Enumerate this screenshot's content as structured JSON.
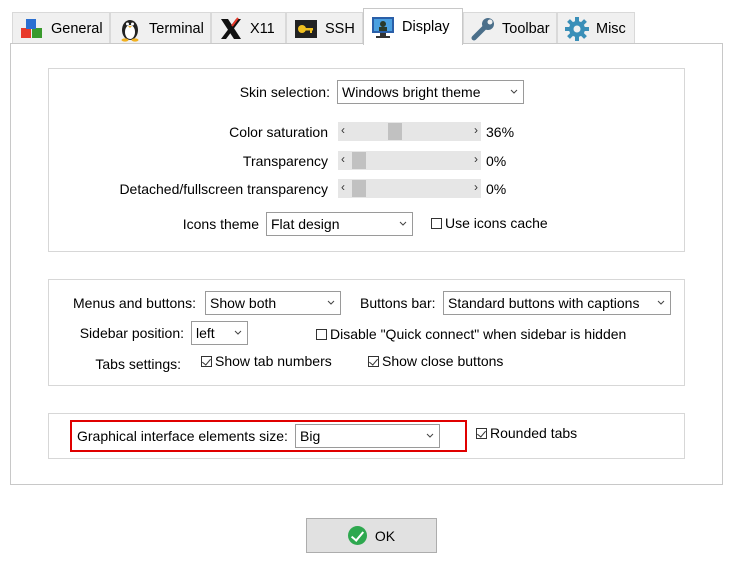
{
  "tabs": [
    {
      "label": "General",
      "icon": "general-cubes-icon",
      "active": false
    },
    {
      "label": "Terminal",
      "icon": "terminal-penguin-icon",
      "active": false
    },
    {
      "label": "X11",
      "icon": "x11-icon",
      "active": false
    },
    {
      "label": "SSH",
      "icon": "ssh-key-icon",
      "active": false
    },
    {
      "label": "Display",
      "icon": "display-monitor-icon",
      "active": true
    },
    {
      "label": "Toolbar",
      "icon": "toolbar-wrench-icon",
      "active": false
    },
    {
      "label": "Misc",
      "icon": "misc-gear-icon",
      "active": false
    }
  ],
  "appearance": {
    "skin_label": "Skin selection:",
    "skin_value": "Windows bright theme",
    "saturation_label": "Color saturation",
    "saturation_value": "36%",
    "saturation_level": 0.36,
    "transparency_label": "Transparency",
    "transparency_value": "0%",
    "transparency_level": 0,
    "detached_label": "Detached/fullscreen transparency",
    "detached_value": "0%",
    "detached_level": 0,
    "icons_theme_label": "Icons theme",
    "icons_theme_value": "Flat design",
    "icons_cache_label": "Use icons cache",
    "icons_cache_checked": false
  },
  "layout": {
    "menus_label": "Menus and buttons:",
    "menus_value": "Show both",
    "buttons_bar_label": "Buttons bar:",
    "buttons_bar_value": "Standard buttons with captions",
    "sidebar_label": "Sidebar position:",
    "sidebar_value": "left",
    "disable_qc_label": "Disable \"Quick connect\" when sidebar is hidden",
    "disable_qc_checked": false,
    "tabs_settings_label": "Tabs settings:",
    "tab_numbers_label": "Show tab numbers",
    "tab_numbers_checked": true,
    "close_buttons_label": "Show close buttons",
    "close_buttons_checked": true
  },
  "size": {
    "gui_size_label": "Graphical interface elements size:",
    "gui_size_value": "Big",
    "rounded_tabs_label": "Rounded tabs",
    "rounded_tabs_checked": true
  },
  "footer": {
    "ok_label": "OK"
  },
  "colors": {
    "highlight": "#e00000",
    "ok_icon": "#2ea84f"
  }
}
